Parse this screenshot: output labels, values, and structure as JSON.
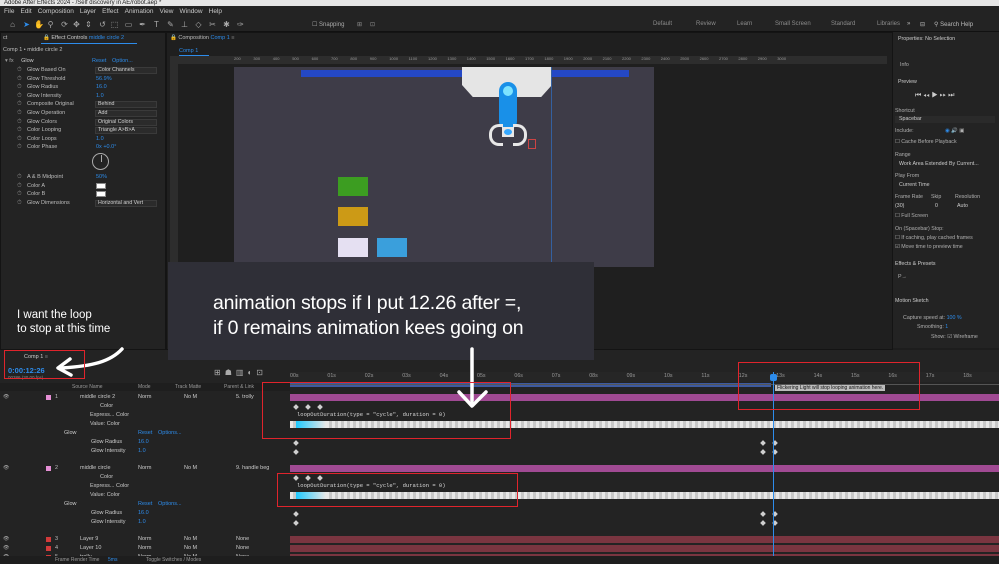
{
  "window": {
    "title": "Adobe After Effects 2024 - /Self discovery in AE/robot.aep *"
  },
  "menu": [
    "File",
    "Edit",
    "Composition",
    "Layer",
    "Effect",
    "Animation",
    "View",
    "Window",
    "Help"
  ],
  "toolbar": {
    "snapping": "Snapping",
    "workspaces": [
      "Default",
      "Review",
      "Learn",
      "Small Screen",
      "Standard",
      "Libraries"
    ],
    "search_help": "Search Help"
  },
  "effect_controls": {
    "tab_left": "ct",
    "tab_label": "Effect Controls",
    "tab_layer": "middle circle 2",
    "comp_path": "Comp 1 • middle circle 2",
    "effect_name": "Glow",
    "reset": "Reset",
    "options": "Option...",
    "rows": [
      {
        "label": "Glow Based On",
        "value": "Color Channels",
        "kind": "drop"
      },
      {
        "label": "Glow Threshold",
        "value": "56.9%",
        "kind": "num"
      },
      {
        "label": "Glow Radius",
        "value": "16.0",
        "kind": "num"
      },
      {
        "label": "Glow Intensity",
        "value": "1.0",
        "kind": "num"
      },
      {
        "label": "Composite Original",
        "value": "Behind",
        "kind": "drop"
      },
      {
        "label": "Glow Operation",
        "value": "Add",
        "kind": "drop"
      },
      {
        "label": "Glow Colors",
        "value": "Original Colors",
        "kind": "drop"
      },
      {
        "label": "Color Looping",
        "value": "Triangle A>B>A",
        "kind": "drop"
      },
      {
        "label": "Color Loops",
        "value": "1.0",
        "kind": "num"
      },
      {
        "label": "Color Phase",
        "value": "0x +0.0°",
        "kind": "num"
      }
    ],
    "rows2": [
      {
        "label": "A & B Midpoint",
        "value": "50%",
        "kind": "num"
      },
      {
        "label": "Color A",
        "value": "",
        "kind": "swatch"
      },
      {
        "label": "Color B",
        "value": "",
        "kind": "swatch"
      },
      {
        "label": "Glow Dimensions",
        "value": "Horizontal and Vert",
        "kind": "drop"
      }
    ]
  },
  "composition": {
    "tab_label": "Composition",
    "tab_comp": "Comp 1",
    "sub_tab": "Comp 1",
    "ruler_ticks": [
      "200",
      "300",
      "400",
      "500",
      "600",
      "700",
      "800",
      "900",
      "1000",
      "1100",
      "1200",
      "1300",
      "1400",
      "1500",
      "1600",
      "1700",
      "1800",
      "1900",
      "2000",
      "2100",
      "2200",
      "2300",
      "2400",
      "2500",
      "2600",
      "2700",
      "2800",
      "2900",
      "3000"
    ]
  },
  "annotations": {
    "main_line1": "animation stops if I put 12.26 after =,",
    "main_line2": "if 0 remains animation kees going on",
    "side_line1": "I want the loop",
    "side_line2": "to stop at this time"
  },
  "timeline": {
    "comp_tab": "Comp 1",
    "timecode": "0:00:12:26",
    "fps": "00386 (30.00 fps)",
    "col_source": "Source Name",
    "col_mode": "Mode",
    "col_track": "Track Matte",
    "col_parent": "Parent & Link",
    "time_ticks": [
      "00s",
      "01s",
      "02s",
      "03s",
      "04s",
      "05s",
      "06s",
      "07s",
      "08s",
      "09s",
      "10s",
      "11s",
      "12s",
      "13s",
      "14s",
      "15s",
      "16s",
      "17s",
      "18s"
    ],
    "marker_comment": "Flickering Light will stop looping animation here.",
    "footer_left": "Frame Render Time",
    "footer_time": "5ms",
    "footer_right": "Toggle Switches / Modes",
    "layers": [
      {
        "num": "1",
        "name": "middle circle 2",
        "mode": "Norm",
        "matte": "No M",
        "parent": "5. trolly",
        "color": "#e58fd5"
      },
      {
        "num": "",
        "name": "Color",
        "mode": "",
        "matte": "",
        "parent": "",
        "color": ""
      },
      {
        "num": "",
        "name": "Express... Color",
        "mode": "",
        "matte": "",
        "parent": "",
        "color": ""
      },
      {
        "num": "",
        "name": "Value: Color",
        "mode": "",
        "matte": "",
        "parent": "",
        "color": ""
      },
      {
        "num": "",
        "name": "Glow",
        "mode": "Reset",
        "matte": "Options...",
        "parent": "",
        "color": ""
      },
      {
        "num": "",
        "name": "Glow Radius",
        "mode": "16.0",
        "matte": "",
        "parent": "",
        "color": ""
      },
      {
        "num": "",
        "name": "Glow Intensity",
        "mode": "1.0",
        "matte": "",
        "parent": "",
        "color": ""
      },
      {
        "num": "2",
        "name": "middle circle",
        "mode": "Norm",
        "matte": "No M",
        "parent": "9. handle beg",
        "color": "#e58fd5"
      },
      {
        "num": "",
        "name": "Color",
        "mode": "",
        "matte": "",
        "parent": "",
        "color": ""
      },
      {
        "num": "",
        "name": "Express... Color",
        "mode": "",
        "matte": "",
        "parent": "",
        "color": ""
      },
      {
        "num": "",
        "name": "Value: Color",
        "mode": "",
        "matte": "",
        "parent": "",
        "color": ""
      },
      {
        "num": "",
        "name": "Glow",
        "mode": "Reset",
        "matte": "Options...",
        "parent": "",
        "color": ""
      },
      {
        "num": "",
        "name": "Glow Radius",
        "mode": "16.0",
        "matte": "",
        "parent": "",
        "color": ""
      },
      {
        "num": "",
        "name": "Glow Intensity",
        "mode": "1.0",
        "matte": "",
        "parent": "",
        "color": ""
      },
      {
        "num": "3",
        "name": "Layer 9",
        "mode": "Norm",
        "matte": "No M",
        "parent": "None",
        "color": "#d23a3a"
      },
      {
        "num": "4",
        "name": "Layer 10",
        "mode": "Norm",
        "matte": "No M",
        "parent": "None",
        "color": "#d23a3a"
      },
      {
        "num": "5",
        "name": "trolly",
        "mode": "Norm",
        "matte": "No M",
        "parent": "None",
        "color": "#d23a3a"
      }
    ],
    "expression1": "loopOutDuration(type = \"cycle\", duration = 0)",
    "expression2": "loopOutDuration(type = \"cycle\", duration = 0)"
  },
  "right_panel": {
    "properties": "Properties: No Selection",
    "info": "Info",
    "preview": "Preview",
    "shortcut": "Shortcut",
    "shortcut_value": "Spacebar",
    "include": "Include:",
    "cache": "Cache Before Playback",
    "range": "Range",
    "range_value": "Work Area Extended By Current...",
    "play_from": "Play From",
    "play_from_value": "Current Time",
    "frame_rate": "Frame Rate",
    "skip": "Skip",
    "resolution": "Resolution",
    "frame_rate_value": "(30)",
    "skip_value": "0",
    "resolution_value": "Auto",
    "full_screen": "Full Screen",
    "on_stop": "On (Spacebar) Stop:",
    "if_caching": "If caching, play cached frames",
    "move_time": "Move time to preview time",
    "effects_presets": "Effects & Presets",
    "search_prefix": "P→",
    "motion_sketch": "Motion Sketch",
    "capture_speed": "Capture speed at:",
    "capture_value": "100 %",
    "smoothing": "Smoothing:",
    "smoothing_value": "1",
    "show": "Show:",
    "wireframe": "Wireframe"
  }
}
